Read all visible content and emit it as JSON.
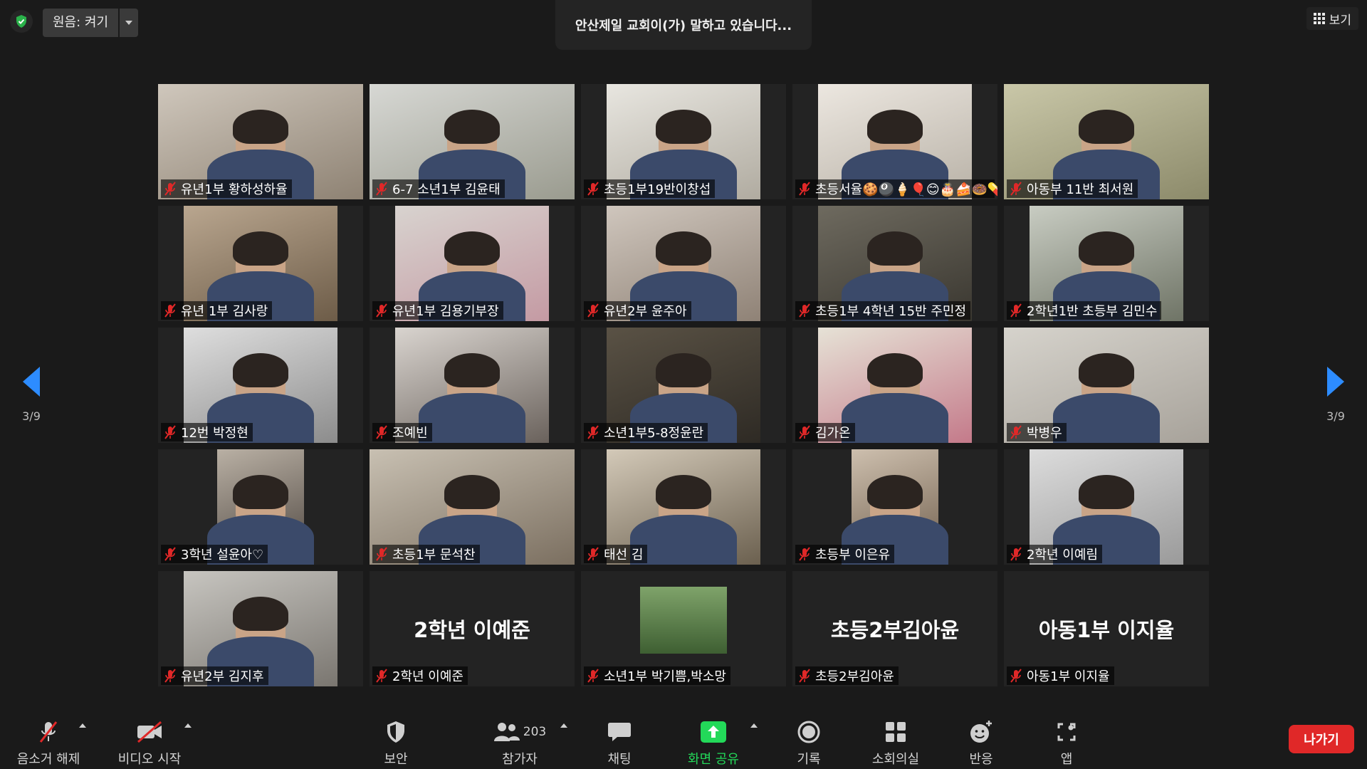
{
  "top": {
    "original_sound_label": "원음: 켜기",
    "speaking_text": "안산제일 교회이(가) 말하고 있습니다...",
    "view_label": "보기"
  },
  "pagination": {
    "left": "3/9",
    "right": "3/9"
  },
  "participants": [
    {
      "name": "유년1부 황하성하율",
      "video": true
    },
    {
      "name": "6-7 소년1부 김윤태",
      "video": true
    },
    {
      "name": "초등1부19반이창섭",
      "video": true
    },
    {
      "name": "초등서율🍪🎱🍦🎈😊🎂🍰🍩💊",
      "video": true
    },
    {
      "name": "아동부 11반 최서원",
      "video": true
    },
    {
      "name": "유년 1부 김사랑",
      "video": true
    },
    {
      "name": "유년1부 김용기부장",
      "video": true
    },
    {
      "name": "유년2부 윤주아",
      "video": true
    },
    {
      "name": "초등1부 4학년 15반 주민정",
      "video": true
    },
    {
      "name": "2학년1반 초등부 김민수",
      "video": true
    },
    {
      "name": "12번 박정현",
      "video": true
    },
    {
      "name": "조예빈",
      "video": true
    },
    {
      "name": "소년1부5-8정윤란",
      "video": true
    },
    {
      "name": "김가온",
      "video": true
    },
    {
      "name": "박병우",
      "video": true
    },
    {
      "name": "3학년 설윤아♡",
      "video": true
    },
    {
      "name": "초등1부 문석찬",
      "video": true
    },
    {
      "name": "태선 김",
      "video": true
    },
    {
      "name": "초등부 이은유",
      "video": true
    },
    {
      "name": "2학년 이예림",
      "video": true
    },
    {
      "name": "유년2부 김지후",
      "video": true
    },
    {
      "name": "2학년 이예준",
      "video": false,
      "display": "2학년 이예준"
    },
    {
      "name": "소년1부 박기쁨,박소망",
      "video": true
    },
    {
      "name": "초등2부김아윤",
      "video": false,
      "display": "초등2부김아윤"
    },
    {
      "name": "아동1부 이지율",
      "video": false,
      "display": "아동1부 이지율"
    }
  ],
  "toolbar": {
    "unmute": "음소거 해제",
    "start_video": "비디오 시작",
    "security": "보안",
    "participants": "참가자",
    "participant_count": "203",
    "chat": "채팅",
    "share_screen": "화면 공유",
    "record": "기록",
    "breakout_rooms": "소회의실",
    "reactions": "반응",
    "apps": "앱",
    "leave": "나가기"
  },
  "colors": {
    "accent": "#2d8cff",
    "share_green": "#23d959",
    "leave_red": "#e02828",
    "mic_off_red": "#e02828"
  }
}
